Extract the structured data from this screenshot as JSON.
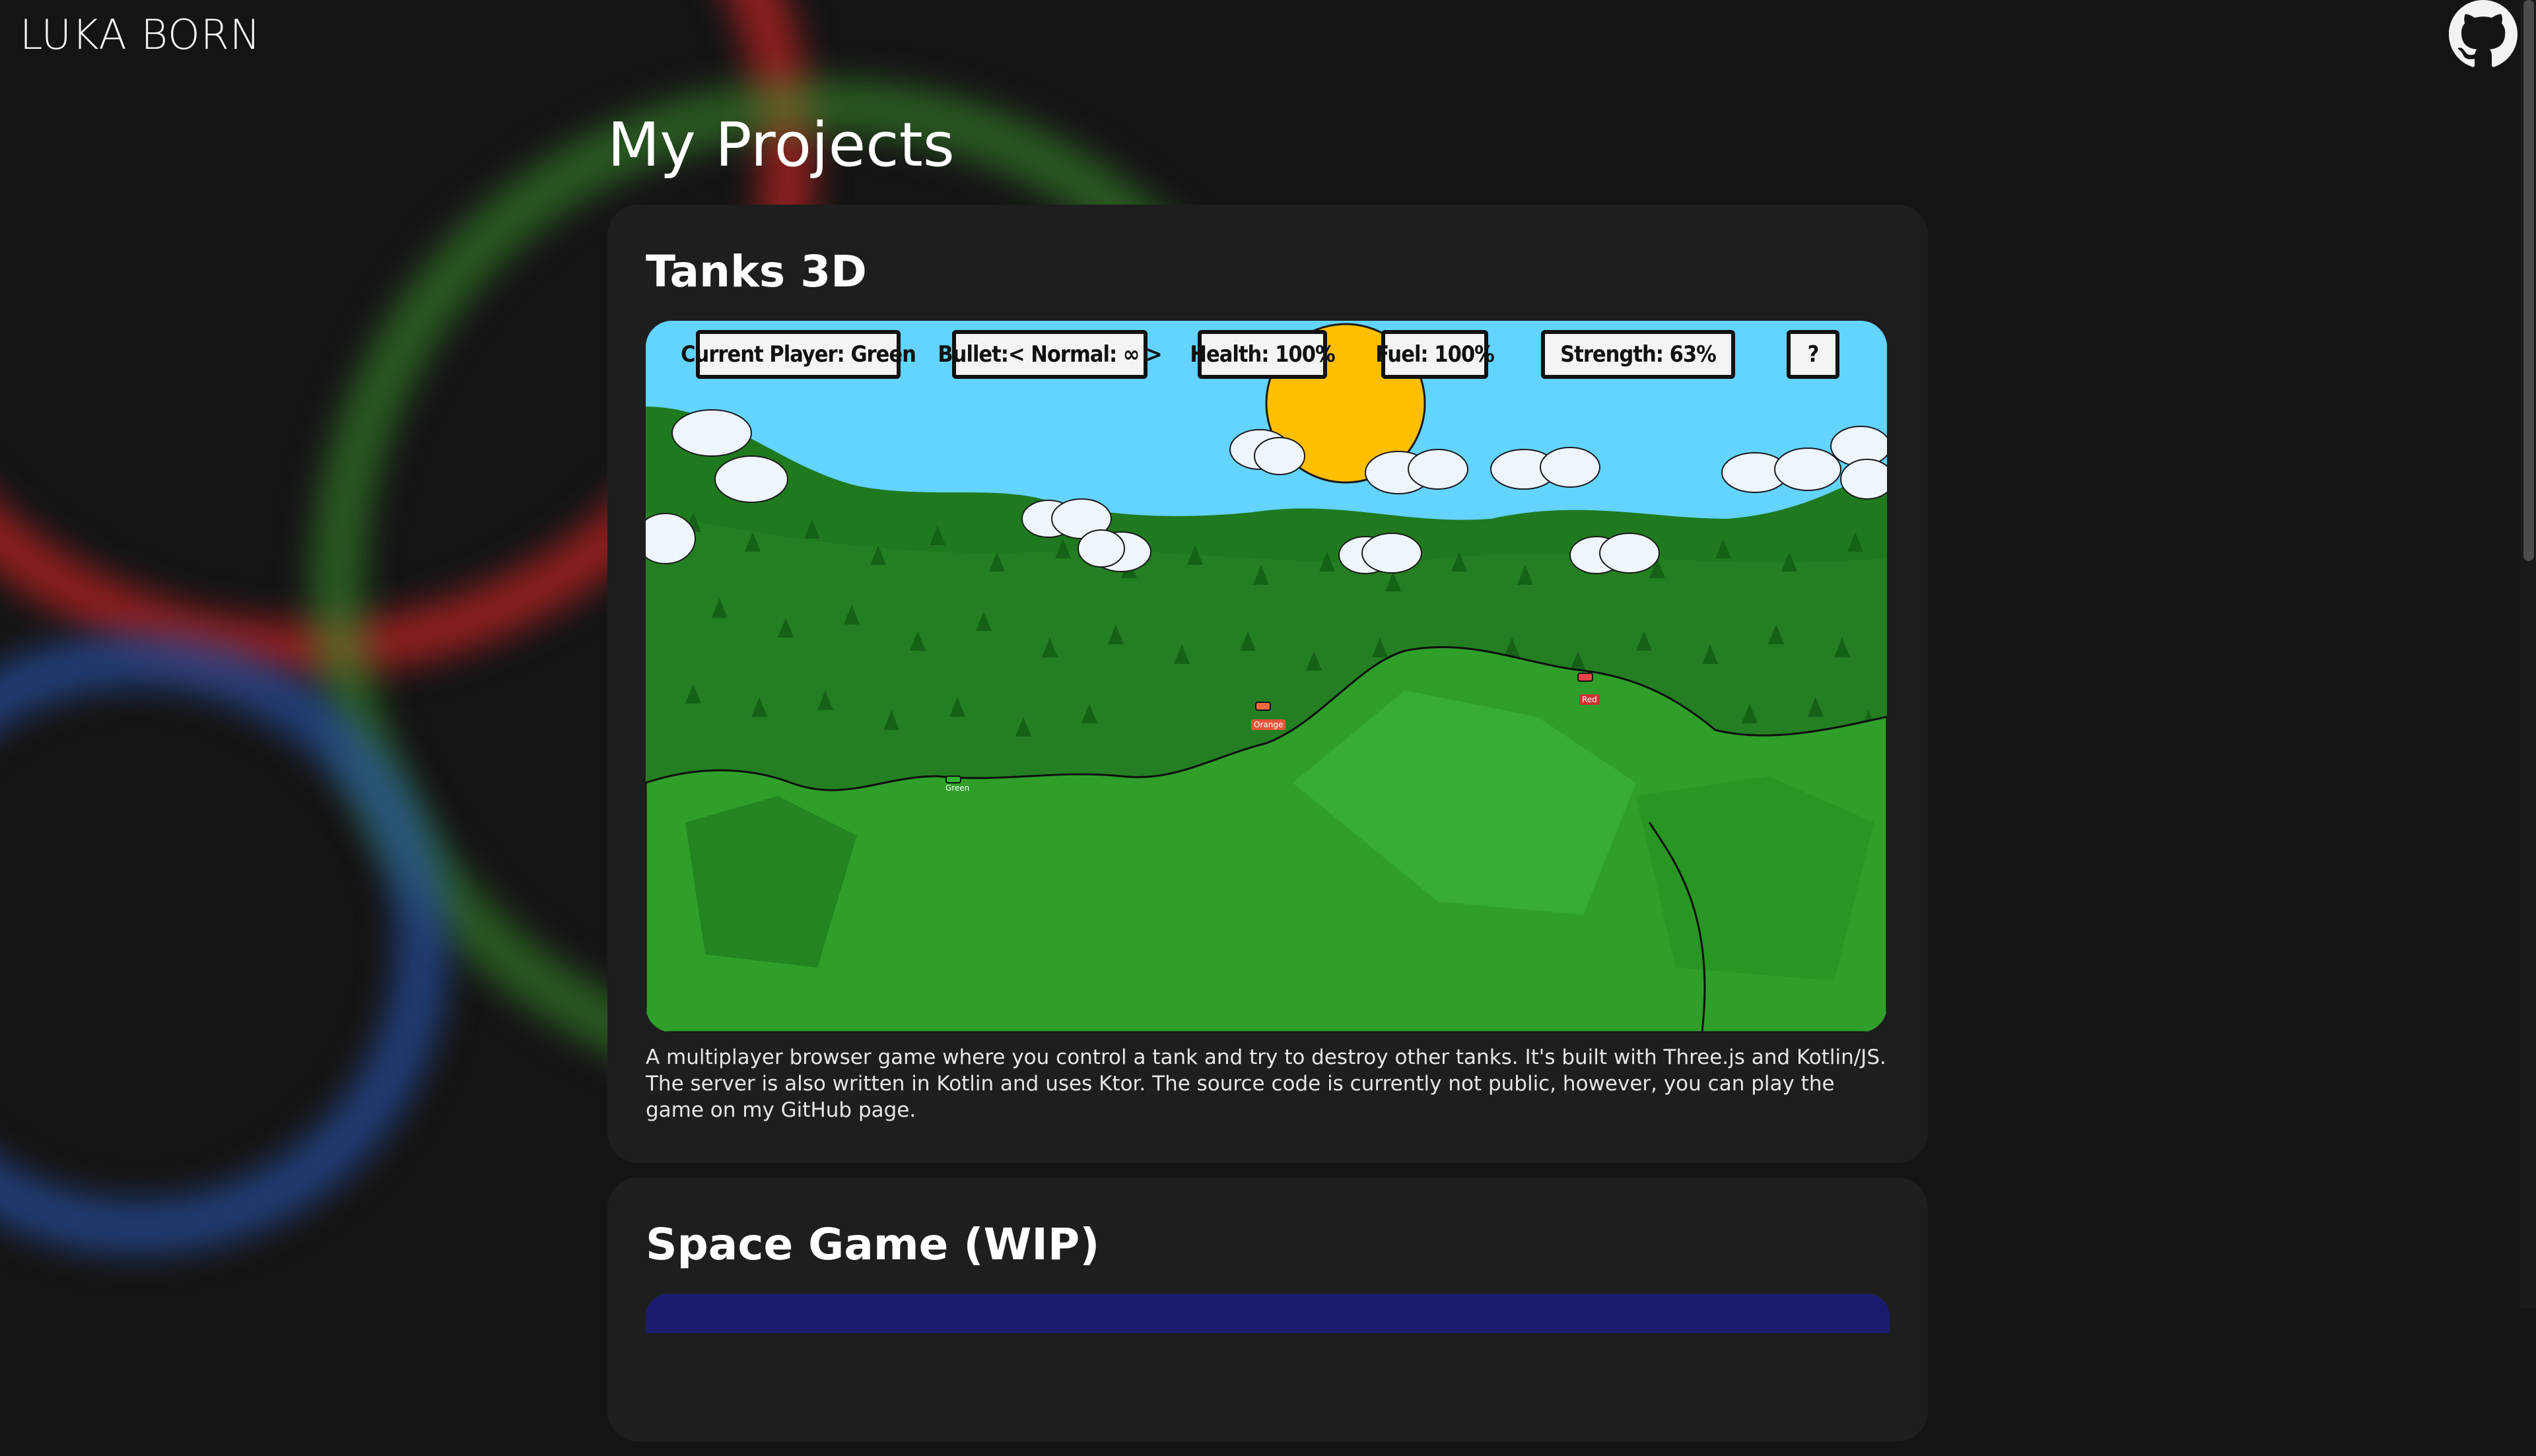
{
  "site": {
    "brand": "LUKA BORN",
    "github_icon": "github-icon"
  },
  "page": {
    "title": "My Projects"
  },
  "projects": [
    {
      "title": "Tanks 3D",
      "hud": {
        "current_player": "Current Player: Green",
        "bullet": "Bullet:< Normal: ∞ >",
        "health": "Health: 100%",
        "fuel": "Fuel: 100%",
        "strength": "Strength: 63%",
        "help": "?"
      },
      "tank_labels": {
        "green": "Green",
        "orange": "Orange",
        "red": "Red"
      },
      "description": "A multiplayer browser game where you control a tank and try to destroy other tanks. It's built with Three.js and Kotlin/JS. The server is also written in Kotlin and uses Ktor. The source code is currently not public, however, you can play the game on my GitHub page."
    },
    {
      "title": "Space Game (WIP)"
    }
  ],
  "colors": {
    "background": "#141414",
    "card": "#1e1e1e",
    "sky": "#63d3ff",
    "sun": "#ffbf00",
    "grass": "#2e9e2a"
  }
}
